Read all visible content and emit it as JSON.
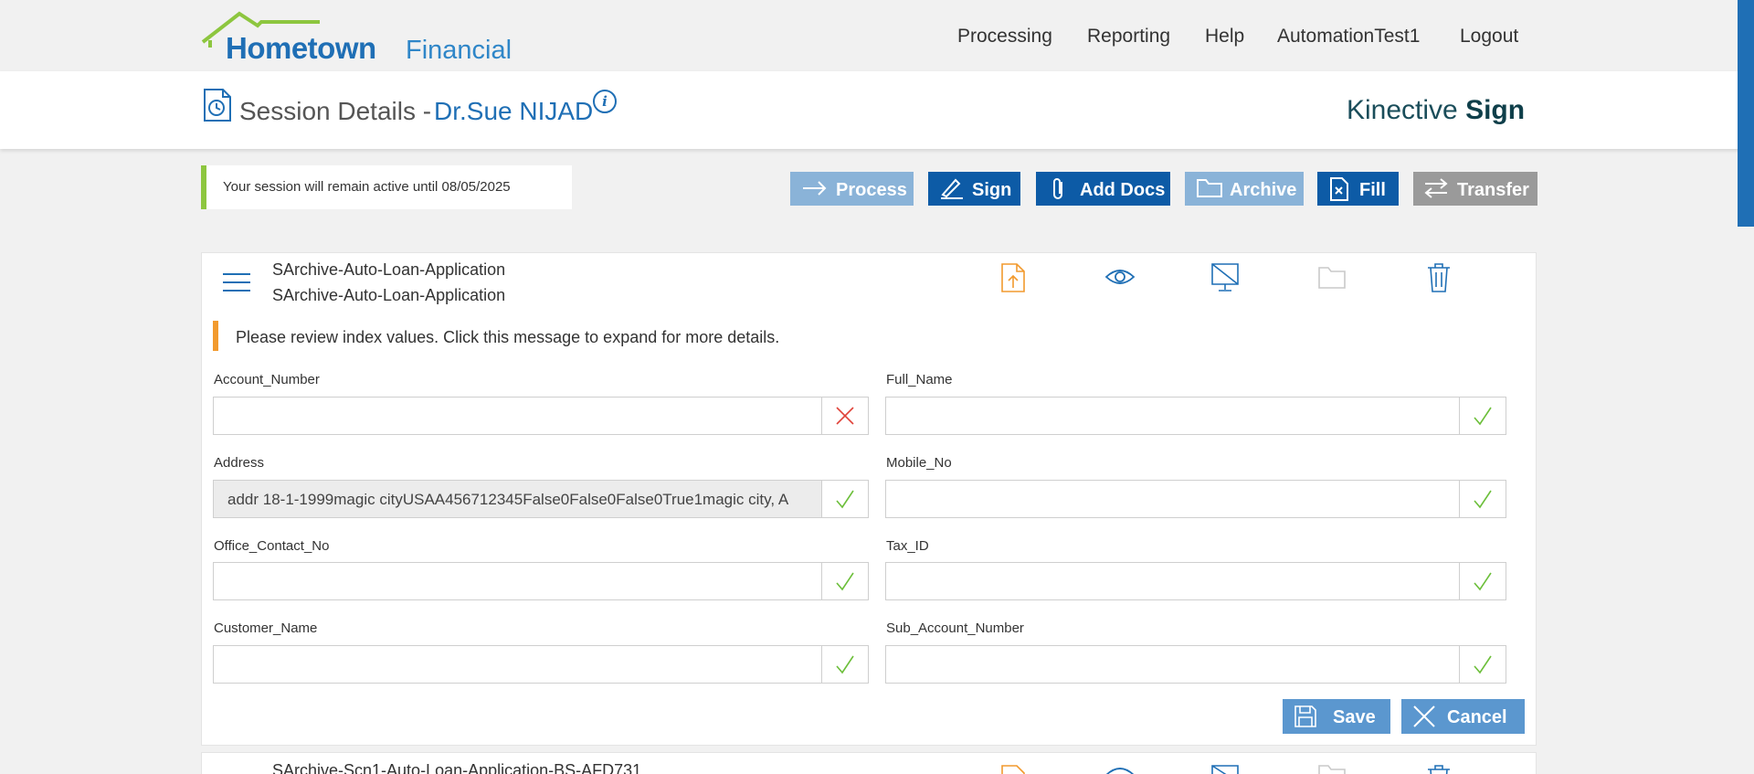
{
  "app": {
    "logo_main": "Hometown",
    "logo_sub": "Financial",
    "nav": [
      "Processing",
      "Reporting",
      "Help",
      "AutomationTest1",
      "Logout"
    ]
  },
  "session": {
    "title": "Session Details -",
    "name": "Dr.Sue NIJAD",
    "brand_light": "Kinective",
    "brand_bold": "Sign",
    "notice": "Your session will remain active until 08/05/2025"
  },
  "actions": {
    "process": "Process",
    "sign": "Sign",
    "add_docs": "Add Docs",
    "archive": "Archive",
    "fill": "Fill",
    "transfer": "Transfer"
  },
  "document": {
    "name_line1": "SArchive-Auto-Loan-Application",
    "name_line2": "SArchive-Auto-Loan-Application",
    "review_message": "Please review index values. Click this message to expand for more details.",
    "fields": [
      {
        "label": "Account_Number",
        "value": "",
        "status": "invalid"
      },
      {
        "label": "Full_Name",
        "value": "",
        "status": "valid"
      },
      {
        "label": "Address",
        "value": "addr 18-1-1999magic cityUSAA456712345False0False0False0True1magic city, A",
        "status": "valid"
      },
      {
        "label": "Mobile_No",
        "value": "",
        "status": "valid"
      },
      {
        "label": "Office_Contact_No",
        "value": "",
        "status": "valid"
      },
      {
        "label": "Tax_ID",
        "value": "",
        "status": "valid"
      },
      {
        "label": "Customer_Name",
        "value": "",
        "status": "valid"
      },
      {
        "label": "Sub_Account_Number",
        "value": "",
        "status": "valid"
      }
    ],
    "save_label": "Save",
    "cancel_label": "Cancel"
  },
  "next_document": {
    "name": "SArchive-Scn1-Auto-Loan-Application-BS-AFD731"
  },
  "colors": {
    "primary": "#0d5ba6",
    "primary_light": "#8ab3d8",
    "accent_green": "#8dc63f",
    "accent_orange": "#f29a2e",
    "error_red": "#e0443a"
  }
}
